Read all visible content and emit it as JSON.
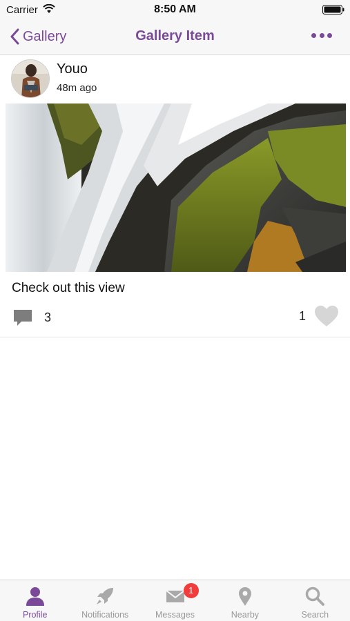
{
  "status_bar": {
    "carrier": "Carrier",
    "time": "8:50 AM"
  },
  "nav": {
    "back_label": "Gallery",
    "title": "Gallery Item",
    "more_icon": "ellipsis-icon"
  },
  "post": {
    "author": "Youo",
    "time_ago": "48m ago",
    "caption": "Check out this view",
    "comments": "3",
    "likes": "1"
  },
  "tabs": [
    {
      "label": "Profile",
      "icon": "person-icon",
      "active": true
    },
    {
      "label": "Notifications",
      "icon": "rocket-icon"
    },
    {
      "label": "Messages",
      "icon": "envelope-icon",
      "badge": "1"
    },
    {
      "label": "Nearby",
      "icon": "map-pin-icon"
    },
    {
      "label": "Search",
      "icon": "magnifier-icon"
    }
  ],
  "colors": {
    "accent": "#7a4a99",
    "inactive": "#999999",
    "badge": "#f23b3b"
  }
}
